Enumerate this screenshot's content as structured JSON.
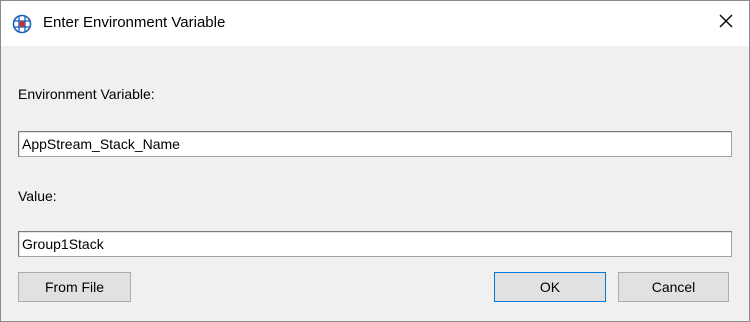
{
  "window": {
    "title": "Enter Environment Variable",
    "icon": "globe-grid-icon",
    "close_icon": "close-icon"
  },
  "form": {
    "variable_label": "Environment Variable:",
    "variable_value": "AppStream_Stack_Name",
    "value_label": "Value:",
    "value_value": "Group1Stack"
  },
  "buttons": {
    "from_file": "From File",
    "ok": "OK",
    "cancel": "Cancel"
  },
  "colors": {
    "dialog_background": "#f0f0f0",
    "titlebar_background": "#ffffff",
    "icon_blue": "#1a5fb4",
    "icon_red": "#d7262a"
  }
}
